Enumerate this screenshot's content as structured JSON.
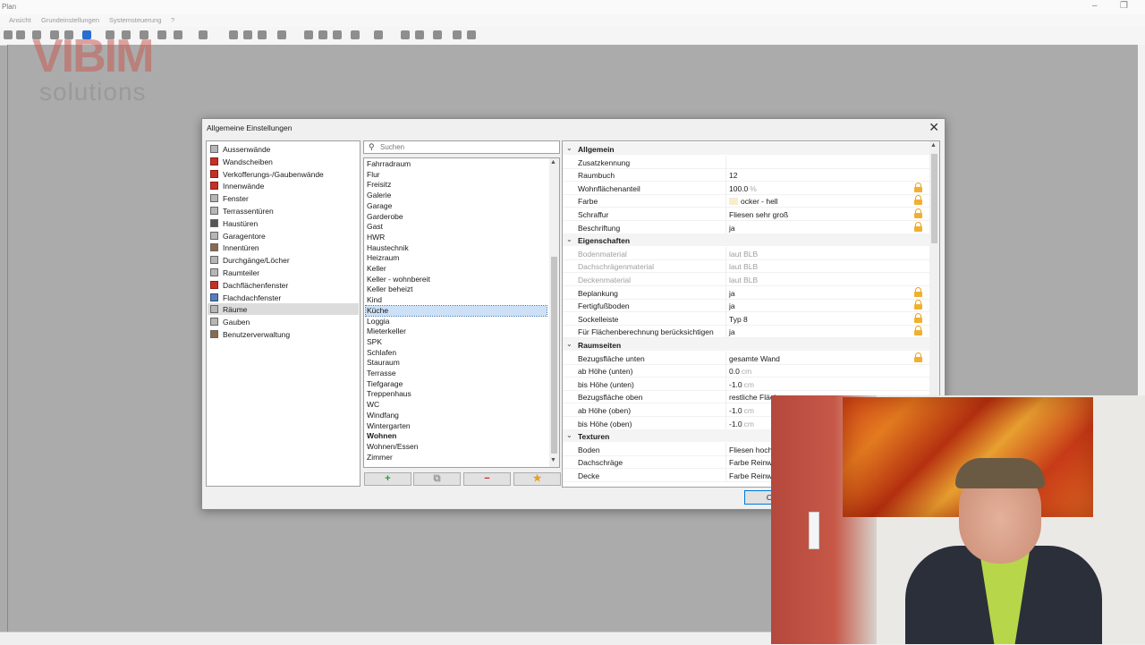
{
  "app": {
    "title": "Plan",
    "menu": [
      "Ansicht",
      "Grundeinstellungen",
      "Systemsteuerung",
      "?"
    ],
    "logo_top": "VIBIM",
    "logo_bottom": "solutions"
  },
  "dialog": {
    "title": "Allgemeine Einstellungen",
    "close_symbol": "✕",
    "ok_label": "OK",
    "categories": [
      {
        "label": "Aussenwände",
        "icon": "wall-icon"
      },
      {
        "label": "Wandscheiben",
        "icon": "wall-panel-icon"
      },
      {
        "label": "Verkofferungs-/Gaubenwände",
        "icon": "dormer-wall-icon"
      },
      {
        "label": "Innenwände",
        "icon": "inner-wall-icon"
      },
      {
        "label": "Fenster",
        "icon": "window-icon"
      },
      {
        "label": "Terrassentüren",
        "icon": "terrace-door-icon"
      },
      {
        "label": "Haustüren",
        "icon": "front-door-icon"
      },
      {
        "label": "Garagentore",
        "icon": "garage-door-icon"
      },
      {
        "label": "Innentüren",
        "icon": "inner-door-icon"
      },
      {
        "label": "Durchgänge/Löcher",
        "icon": "opening-icon"
      },
      {
        "label": "Raumteiler",
        "icon": "room-divider-icon"
      },
      {
        "label": "Dachflächenfenster",
        "icon": "roof-window-icon"
      },
      {
        "label": "Flachdachfenster",
        "icon": "flat-roof-window-icon"
      },
      {
        "label": "Räume",
        "icon": "rooms-icon"
      },
      {
        "label": "Gauben",
        "icon": "dormer-icon"
      },
      {
        "label": "Benutzerverwaltung",
        "icon": "users-icon"
      }
    ],
    "selected_category": "Räume",
    "search": {
      "placeholder": "Suchen"
    },
    "rooms": [
      "Fahrradraum",
      "Flur",
      "Freisitz",
      "Galerie",
      "Garage",
      "Garderobe",
      "Gast",
      "HWR",
      "Haustechnik",
      "Heizraum",
      "Keller",
      "Keller - wohnbereit",
      "Keller beheizt",
      "Kind",
      "Küche",
      "Loggia",
      "Mieterkeller",
      "SPK",
      "Schlafen",
      "Stauraum",
      "Terrasse",
      "Tiefgarage",
      "Treppenhaus",
      "WC",
      "Windfang",
      "Wintergarten",
      "Wohnen",
      "Wohnen/Essen",
      "Zimmer"
    ],
    "selected_room": "Küche",
    "bold_room": "Wohnen",
    "list_buttons": [
      {
        "symbol": "+",
        "name": "add-room-button",
        "color": "#2e9b3a"
      },
      {
        "symbol": "⧉",
        "name": "copy-room-button",
        "color": "#9a9a9a"
      },
      {
        "symbol": "−",
        "name": "remove-room-button",
        "color": "#d32020"
      },
      {
        "symbol": "★",
        "name": "favorite-room-button",
        "color": "#e8a020"
      }
    ],
    "properties": [
      {
        "type": "head",
        "label": "Allgemein"
      },
      {
        "type": "row",
        "label": "Zusatzkennung",
        "value": ""
      },
      {
        "type": "row",
        "label": "Raumbuch",
        "value": "12"
      },
      {
        "type": "row",
        "label": "Wohnflächenanteil",
        "value": "100.0",
        "unit": "%",
        "lock": true
      },
      {
        "type": "row",
        "label": "Farbe",
        "value": "ocker - hell",
        "swatch": "#f6eecc",
        "lock": true
      },
      {
        "type": "row",
        "label": "Schraffur",
        "value": "Fliesen sehr groß",
        "lock": true
      },
      {
        "type": "row",
        "label": "Beschriftung",
        "value": "ja",
        "lock": true
      },
      {
        "type": "head",
        "label": "Eigenschaften"
      },
      {
        "type": "row",
        "label": "Bodenmaterial",
        "value": "laut BLB",
        "dim": true
      },
      {
        "type": "row",
        "label": "Dachschrägenmaterial",
        "value": "laut BLB",
        "dim": true
      },
      {
        "type": "row",
        "label": "Deckenmaterial",
        "value": "laut BLB",
        "dim": true
      },
      {
        "type": "row",
        "label": "Beplankung",
        "value": "ja",
        "lock": true
      },
      {
        "type": "row",
        "label": "Fertigfußboden",
        "value": "ja",
        "lock": true
      },
      {
        "type": "row",
        "label": "Sockelleiste",
        "value": "Typ 8",
        "lock": true
      },
      {
        "type": "row",
        "label": "Für Flächenberechnung berücksichtigen",
        "value": "ja",
        "lock": true
      },
      {
        "type": "head",
        "label": "Raumseiten"
      },
      {
        "type": "row",
        "label": "Bezugsfläche unten",
        "value": "gesamte Wand",
        "lock": true
      },
      {
        "type": "row",
        "label": "ab Höhe (unten)",
        "value": "0.0",
        "unit": "cm"
      },
      {
        "type": "row",
        "label": "bis Höhe (unten)",
        "value": "-1.0",
        "unit": "cm"
      },
      {
        "type": "row",
        "label": "Bezugsfläche oben",
        "value": "restliche Fläche"
      },
      {
        "type": "row",
        "label": "ab Höhe (oben)",
        "value": "-1.0",
        "unit": "cm"
      },
      {
        "type": "row",
        "label": "bis Höhe (oben)",
        "value": "-1.0",
        "unit": "cm"
      },
      {
        "type": "head",
        "label": "Texturen"
      },
      {
        "type": "row",
        "label": "Boden",
        "value": "Fliesen hoch"
      },
      {
        "type": "row",
        "label": "Dachschräge",
        "value": "Farbe Reinwe"
      },
      {
        "type": "row",
        "label": "Decke",
        "value": "Farbe Reinwe"
      }
    ]
  }
}
